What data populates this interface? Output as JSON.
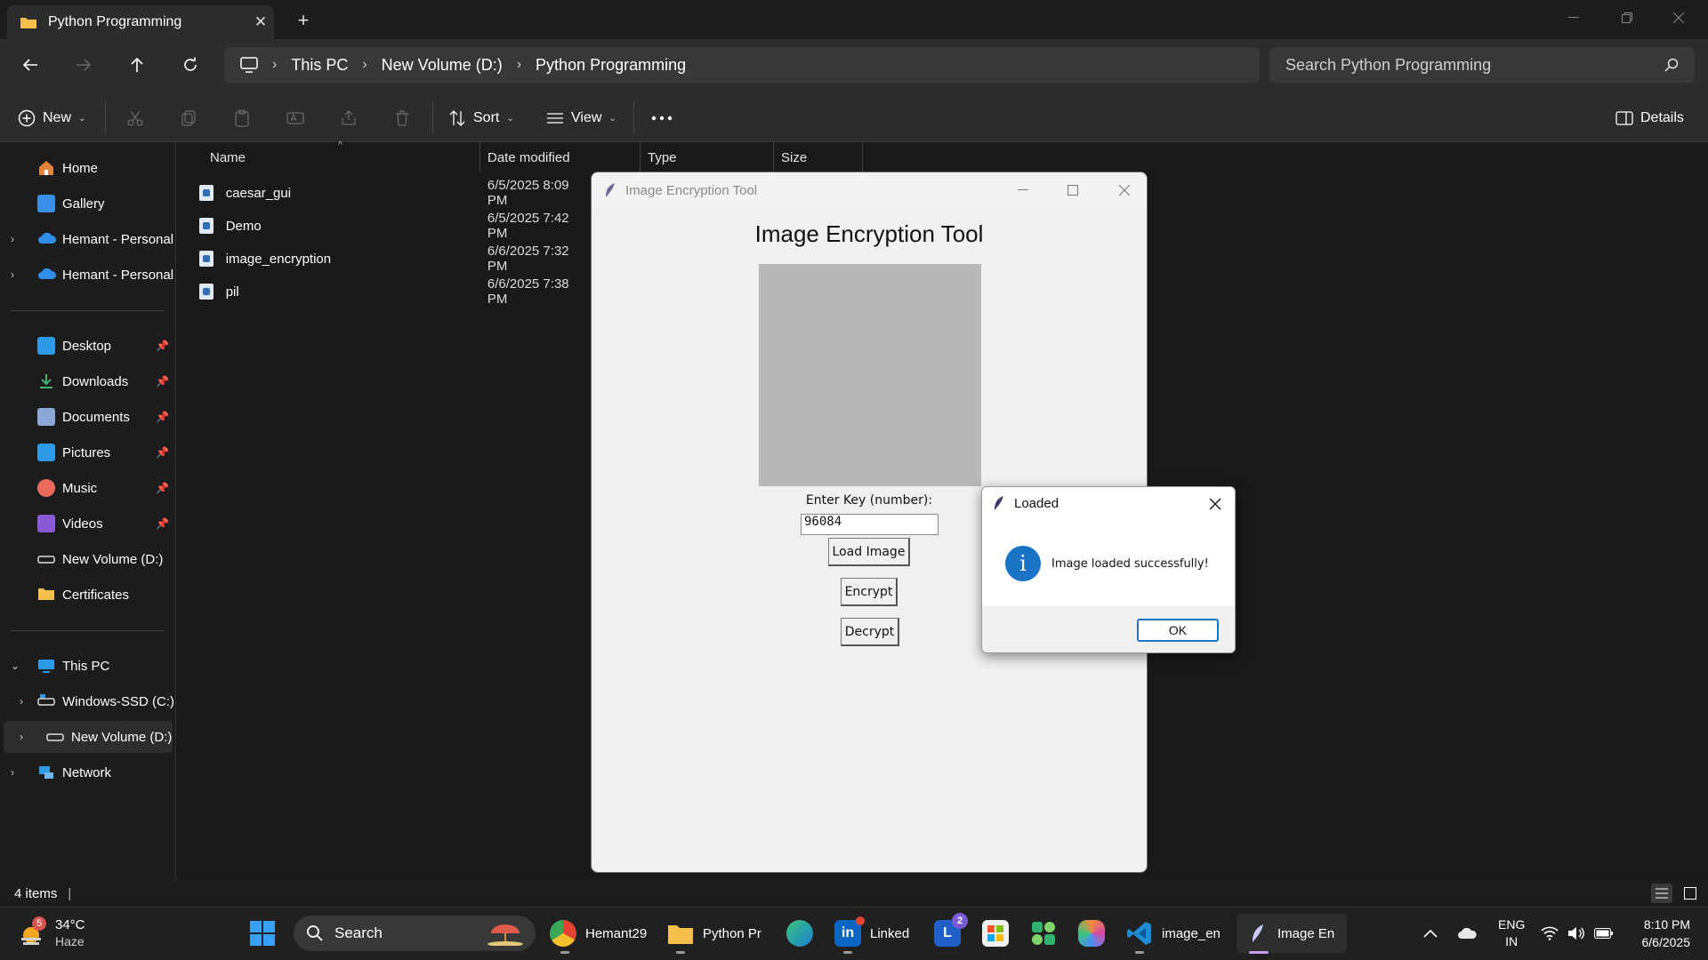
{
  "explorer": {
    "tab_title": "Python Programming",
    "breadcrumb": [
      "This PC",
      "New Volume (D:)",
      "Python Programming"
    ],
    "search_placeholder": "Search Python Programming",
    "commands": {
      "new": "New",
      "sort": "Sort",
      "view": "View",
      "details": "Details"
    },
    "nav": {
      "home": "Home",
      "gallery": "Gallery",
      "onedrive1": "Hemant - Personal",
      "onedrive2": "Hemant - Personal",
      "desktop": "Desktop",
      "downloads": "Downloads",
      "documents": "Documents",
      "pictures": "Pictures",
      "music": "Music",
      "videos": "Videos",
      "new_volume": "New Volume (D:)",
      "certificates": "Certificates",
      "this_pc": "This PC",
      "windows_ssd": "Windows-SSD (C:)",
      "new_volume_tree": "New Volume (D:)",
      "network": "Network"
    },
    "columns": {
      "name": "Name",
      "date": "Date modified",
      "type": "Type",
      "size": "Size"
    },
    "files": [
      {
        "name": "caesar_gui",
        "date": "6/5/2025 8:09 PM"
      },
      {
        "name": "Demo",
        "date": "6/5/2025 7:42 PM"
      },
      {
        "name": "image_encryption",
        "date": "6/6/2025 7:32 PM"
      },
      {
        "name": "pil",
        "date": "6/6/2025 7:38 PM"
      }
    ],
    "status": "4 items"
  },
  "app": {
    "window_title": "Image Encryption Tool",
    "heading": "Image Encryption Tool",
    "key_label": "Enter Key (number):",
    "key_value": "96084",
    "load_button": "Load Image",
    "encrypt_button": "Encrypt",
    "decrypt_button": "Decrypt"
  },
  "dialog": {
    "title": "Loaded",
    "message": "Image loaded successfully!",
    "ok": "OK"
  },
  "taskbar": {
    "weather_temp": "34°C",
    "weather_desc": "Haze",
    "weather_badge": "5",
    "search": "Search",
    "chrome": "Hemant29",
    "explorer": "Python Pr",
    "linkedin": "Linked",
    "l_badge": "2",
    "vscode": "image_en",
    "tk": "Image En",
    "lang1": "ENG",
    "lang2": "IN",
    "time": "8:10 PM",
    "date": "6/6/2025"
  },
  "colors": {
    "accent": "#1a73c6",
    "folder": "#f2c04b",
    "dark_bg": "#191919"
  }
}
